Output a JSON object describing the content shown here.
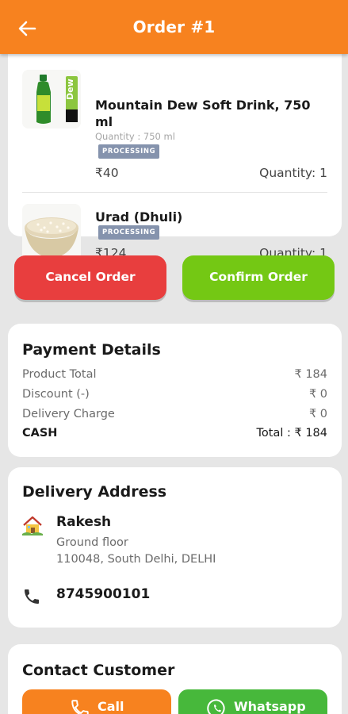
{
  "header": {
    "title": "Order #1",
    "back_icon": "arrow-left-icon"
  },
  "items": [
    {
      "name": "Mountain Dew Soft Drink, 750 ml",
      "quantity_label": "Quantity : 750 ml",
      "status": "PROCESSING",
      "price": "₹40",
      "quantity": "Quantity: 1"
    },
    {
      "name": "Urad (Dhuli)",
      "status": "PROCESSING",
      "price": "₹124",
      "quantity": "Quantity: 1"
    }
  ],
  "actions": {
    "cancel_label": "Cancel Order",
    "confirm_label": "Confirm Order"
  },
  "payment": {
    "title": "Payment Details",
    "rows": [
      {
        "label": "Product Total",
        "value": "₹ 184"
      },
      {
        "label": "Discount (-)",
        "value": "₹ 0"
      },
      {
        "label": "Delivery Charge",
        "value": "₹ 0"
      },
      {
        "label": "CASH",
        "value": "Total : ₹ 184"
      }
    ]
  },
  "address": {
    "title": "Delivery Address",
    "name": "Rakesh",
    "line1": "Ground floor",
    "line2": "110048, South Delhi, DELHI",
    "phone": "8745900101"
  },
  "contact": {
    "title": "Contact Customer",
    "call_label": "Call",
    "whatsapp_label": "Whatsapp"
  },
  "colors": {
    "header": "#f7821f",
    "cancel": "#e83e3e",
    "confirm": "#74c814",
    "call": "#f7821f",
    "whatsapp": "#47b83b",
    "badge": "#8593ad"
  }
}
